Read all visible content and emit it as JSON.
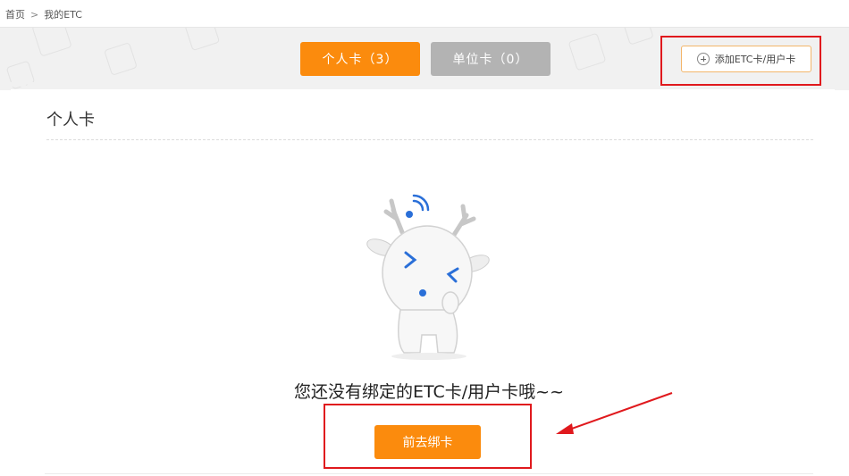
{
  "breadcrumb": {
    "home": "首页",
    "separator": ">",
    "current": "我的ETC"
  },
  "tabs": [
    {
      "label": "个人卡（3）",
      "active": true
    },
    {
      "label": "单位卡（0）",
      "active": false
    }
  ],
  "add_button": {
    "label": "添加ETC卡/用户卡",
    "icon": "plus-circle-icon"
  },
  "section": {
    "title": "个人卡"
  },
  "empty_state": {
    "message": "您还没有绑定的ETC卡/用户卡哦~~",
    "illustration": "deer-mascot"
  },
  "bind_button": {
    "label": "前去绑卡"
  },
  "colors": {
    "accent": "#fb8b0d",
    "inactive_tab": "#b3b3b3",
    "annotation_red": "#e0191d",
    "mascot_blue": "#2a6fd8"
  }
}
